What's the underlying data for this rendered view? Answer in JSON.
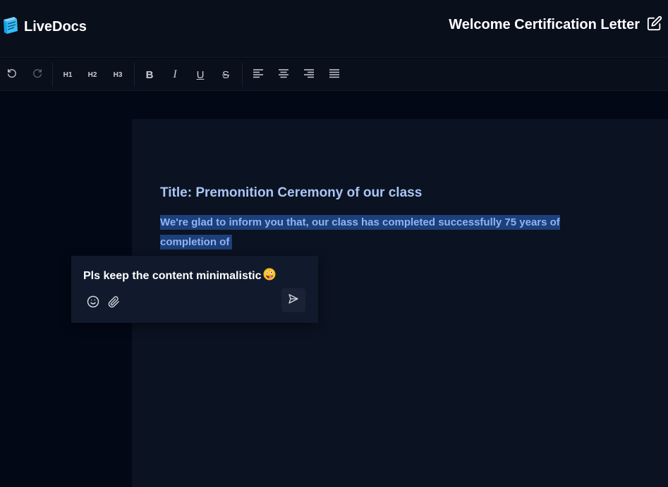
{
  "header": {
    "app_name": "LiveDocs",
    "document_title": "Welcome Certification Letter"
  },
  "toolbar": {
    "h1": "H1",
    "h2": "H2",
    "h3": "H3",
    "bold": "B",
    "italic": "I",
    "underline": "U",
    "strike": "S"
  },
  "document": {
    "title": "Title: Premonition Ceremony of our class",
    "paragraph": "We're glad to inform you that, our class has completed successfully 75 years of completion of"
  },
  "comment": {
    "text": "Pls keep the content minimalistic"
  },
  "colors": {
    "background": "#030712",
    "page": "#0b1221",
    "title": "#a9c5f5",
    "selection": "#1d3f7a"
  }
}
